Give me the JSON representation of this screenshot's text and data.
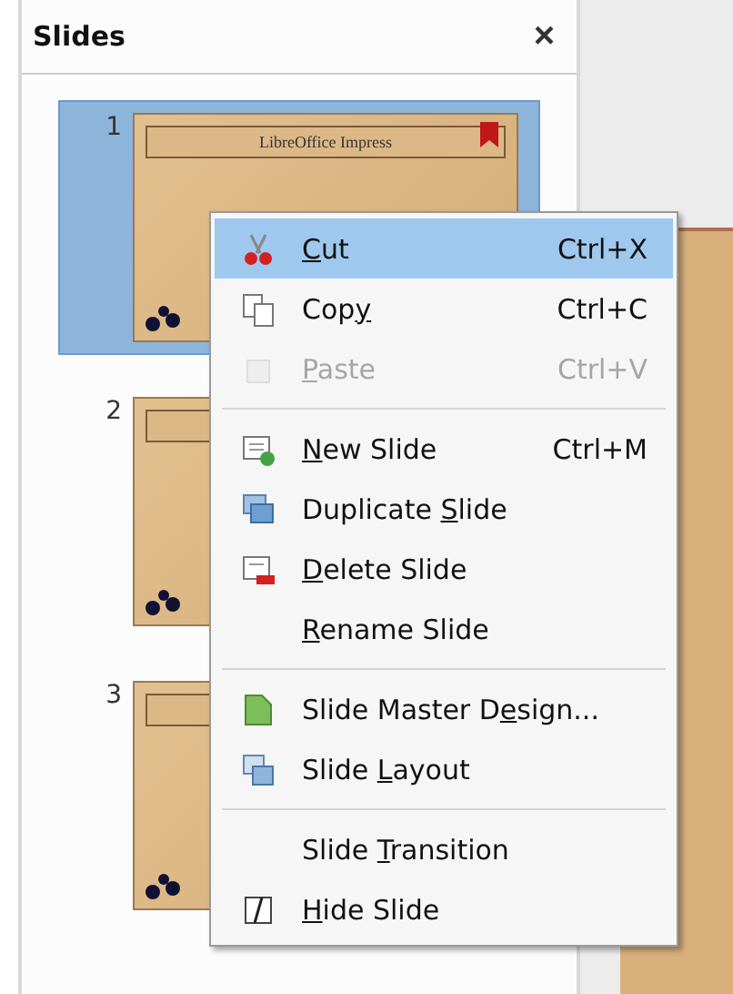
{
  "panel": {
    "title": "Slides",
    "close": "×"
  },
  "slides": [
    {
      "number": "1",
      "title": "LibreOffice Impress",
      "selected": true
    },
    {
      "number": "2",
      "selected": false
    },
    {
      "number": "3",
      "selected": false
    }
  ],
  "context_menu": [
    {
      "kind": "item",
      "mnemonic": "C",
      "after": "ut",
      "shortcut": "Ctrl+X",
      "selected": true,
      "disabled": false
    },
    {
      "kind": "item",
      "before": "Cop",
      "mnemonic": "y",
      "shortcut": "Ctrl+C",
      "selected": false,
      "disabled": false
    },
    {
      "kind": "item",
      "mnemonic": "P",
      "after": "aste",
      "shortcut": "Ctrl+V",
      "selected": false,
      "disabled": true
    },
    {
      "kind": "separator"
    },
    {
      "kind": "item",
      "mnemonic": "N",
      "after": "ew Slide",
      "shortcut": "Ctrl+M",
      "selected": false,
      "disabled": false
    },
    {
      "kind": "item",
      "before": "Duplicate ",
      "mnemonic": "S",
      "after": "lide",
      "selected": false,
      "disabled": false
    },
    {
      "kind": "item",
      "mnemonic": "D",
      "after": "elete Slide",
      "selected": false,
      "disabled": false
    },
    {
      "kind": "item",
      "mnemonic": "R",
      "after": "ename Slide",
      "selected": false,
      "disabled": false
    },
    {
      "kind": "separator"
    },
    {
      "kind": "item",
      "before": "Slide Master D",
      "mnemonic": "e",
      "after": "sign...",
      "selected": false,
      "disabled": false
    },
    {
      "kind": "item",
      "before": "Slide ",
      "mnemonic": "L",
      "after": "ayout",
      "selected": false,
      "disabled": false
    },
    {
      "kind": "separator"
    },
    {
      "kind": "item",
      "before": "Slide ",
      "mnemonic": "T",
      "after": "ransition",
      "selected": false,
      "disabled": false
    },
    {
      "kind": "item",
      "mnemonic": "H",
      "after": "ide Slide",
      "selected": false,
      "disabled": false
    }
  ]
}
